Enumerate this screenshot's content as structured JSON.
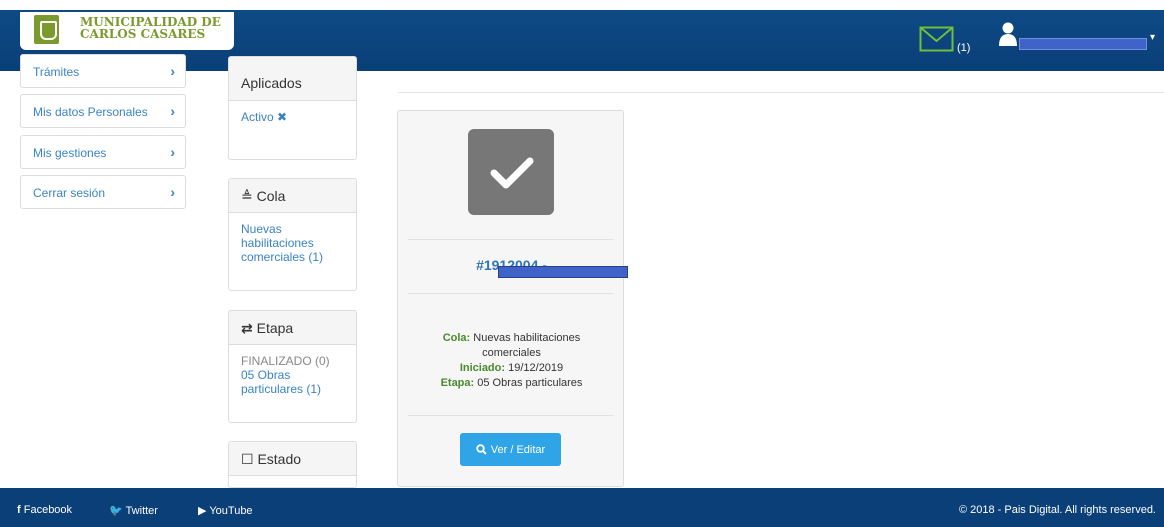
{
  "header": {
    "logo_line1": "MUNICIPALIDAD DE",
    "logo_line2": "CARLOS CASARES",
    "messages_count": "(1)"
  },
  "sidebar": {
    "items": [
      {
        "label": "Trámites"
      },
      {
        "label": "Mis datos Personales"
      },
      {
        "label": "Mis gestiones"
      },
      {
        "label": "Cerrar sesión"
      }
    ]
  },
  "filters": {
    "aplicados": {
      "title": "Aplicados",
      "active_label": "Activo"
    },
    "cola": {
      "title": "Cola",
      "item": "Nuevas habilitaciones comerciales (1)"
    },
    "etapa": {
      "title": "Etapa",
      "item_disabled": "FINALIZADO (0)",
      "item": "05 Obras particulares (1)"
    },
    "estado": {
      "title": "Estado"
    }
  },
  "card": {
    "title": "#1912004 - ",
    "cola_label": "Cola:",
    "cola_value": "Nuevas habilitaciones comerciales",
    "iniciado_label": "Iniciado:",
    "iniciado_value": "19/12/2019",
    "etapa_label": "Etapa:",
    "etapa_value": "05 Obras particulares",
    "button_label": "Ver / Editar"
  },
  "footer": {
    "facebook": "Facebook",
    "twitter": "Twitter",
    "youtube": "YouTube",
    "copyright": "2018 - Pais Digital. All rights reserved."
  },
  "colors": {
    "header_bg": "#0e4a86",
    "link": "#3a83c5",
    "accent_green": "#4a8a2e",
    "button": "#2fa4e7"
  }
}
